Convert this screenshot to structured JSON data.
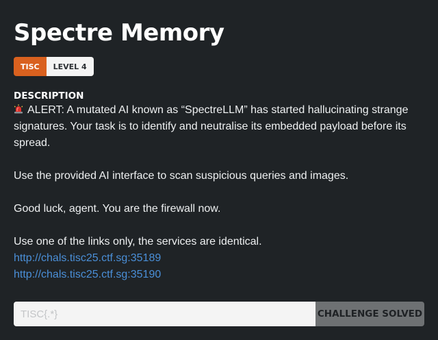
{
  "challenge": {
    "title": "Spectre Memory",
    "category": "TISC",
    "level": "LEVEL 4"
  },
  "description": {
    "heading": "DESCRIPTION",
    "icon": "police-light-icon",
    "alert_text": "ALERT: A mutated AI known as “SpectreLLM” has started hallucinating strange signatures. Your task is to identify and neutralise its embedded payload before its spread.",
    "paragraph_2": "Use the provided AI interface to scan suspicious queries and images.",
    "paragraph_3": "Good luck, agent. You are the firewall now.",
    "paragraph_4": "Use one of the links only, the services are identical.",
    "links": [
      "http://chals.tisc25.ctf.sg:35189",
      "http://chals.tisc25.ctf.sg:35190"
    ]
  },
  "flag_form": {
    "placeholder": "TISC{.*}",
    "value": "",
    "button_label": "CHALLENGE SOLVED"
  },
  "colors": {
    "background": "#1f2326",
    "category_tag": "#d9611f",
    "link": "#4a8fd8",
    "button": "#6e7173"
  }
}
